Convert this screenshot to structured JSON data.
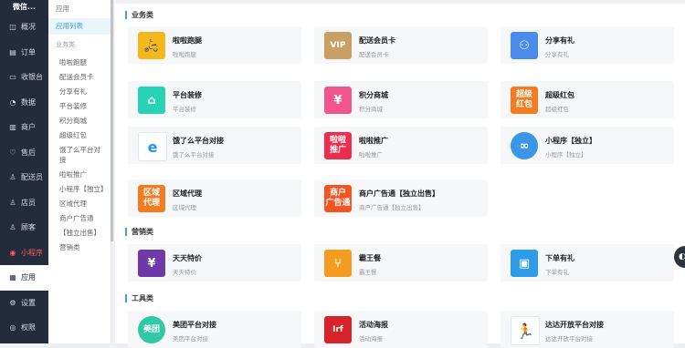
{
  "nav": {
    "brand": "微信...",
    "items": [
      {
        "label": "概况",
        "icon": "overview-icon",
        "glyph": "◫"
      },
      {
        "label": "订单",
        "icon": "order-icon",
        "glyph": "▤"
      },
      {
        "label": "收银台",
        "icon": "cashier-icon",
        "glyph": "▭"
      },
      {
        "label": "数据",
        "icon": "data-icon",
        "glyph": "◔"
      },
      {
        "label": "商户",
        "icon": "merchant-icon",
        "glyph": "▥"
      },
      {
        "label": "售后",
        "icon": "aftersale-icon",
        "glyph": "♡"
      },
      {
        "label": "配送员",
        "icon": "courier-icon",
        "glyph": "♙"
      },
      {
        "label": "店员",
        "icon": "clerk-icon",
        "glyph": "♙"
      },
      {
        "label": "顾客",
        "icon": "customer-icon",
        "glyph": "♙"
      },
      {
        "label": "小程序",
        "icon": "miniapp-icon",
        "glyph": "◉",
        "red": true
      },
      {
        "label": "应用",
        "icon": "apps-icon",
        "glyph": "▦",
        "active": true
      },
      {
        "label": "设置",
        "icon": "settings-icon",
        "glyph": "⚙"
      },
      {
        "label": "权限",
        "icon": "permission-icon",
        "glyph": "◎"
      }
    ]
  },
  "submenu": {
    "title": "应用",
    "active": "应用列表",
    "group": "业务类",
    "items": [
      "啦啦跑腿",
      "配送会员卡",
      "分享有礼",
      "平台装修",
      "积分商城",
      "超级红包",
      "饿了么平台对接",
      "啦啦推广",
      "小程序【独立】",
      "区域代理",
      "商户广告通",
      "【独立出售】",
      "营销类"
    ]
  },
  "sections": [
    {
      "title": "业务类",
      "cards": [
        {
          "name": "啦啦跑腿",
          "desc": "啦啦跑腿",
          "icon": "errand-icon",
          "glyph": "🛵",
          "color": "#f5b81c"
        },
        {
          "name": "配送会员卡",
          "desc": "配送会员卡",
          "icon": "vip-card-icon",
          "glyph": "VIP",
          "color": "#c9a063",
          "text": true
        },
        {
          "name": "分享有礼",
          "desc": "分享有礼",
          "icon": "share-gift-icon",
          "glyph": "⚇",
          "color": "#4a8cee"
        },
        {
          "name": "平台装修",
          "desc": "平台装修",
          "icon": "store-decor-icon",
          "glyph": "⌂",
          "color": "#27d3b4"
        },
        {
          "name": "积分商城",
          "desc": "积分商城",
          "icon": "points-mall-icon",
          "glyph": "¥",
          "color": "#f2548c"
        },
        {
          "name": "超级红包",
          "desc": "超级红包",
          "icon": "red-packet-icon",
          "glyph": "超级\n红包",
          "color": "#f57a20",
          "text": true
        },
        {
          "name": "饿了么平台对接",
          "desc": "饿了么平台对接",
          "icon": "eleme-icon",
          "glyph": "e",
          "color": "#1f96ee",
          "light": true
        },
        {
          "name": "啦啦推广",
          "desc": "啦啦推广",
          "icon": "promotion-icon",
          "glyph": "啦啦\n推广",
          "color": "#ee2d4e",
          "text": true
        },
        {
          "name": "小程序【独立】",
          "desc": "小程序【独立】",
          "icon": "miniprogram-icon",
          "glyph": "∞",
          "color": "#3c96e8",
          "round": true
        },
        {
          "name": "区域代理",
          "desc": "区域代理",
          "icon": "region-agent-icon",
          "glyph": "区域\n代理",
          "color": "#f57a20",
          "text": true
        },
        {
          "name": "商户广告通【独立出售】",
          "desc": "商户广告通【独立出售】",
          "icon": "merchant-ads-icon",
          "glyph": "商户\n广告通",
          "color": "#f5531f",
          "text": true
        }
      ]
    },
    {
      "title": "营销类",
      "cards": [
        {
          "name": "天天特价",
          "desc": "天天特价",
          "icon": "daily-deal-icon",
          "glyph": "¥",
          "color": "#6f3aa8"
        },
        {
          "name": "霸王餐",
          "desc": "霸王餐",
          "icon": "free-meal-icon",
          "glyph": "⑂",
          "color": "#f59b1f"
        },
        {
          "name": "下单有礼",
          "desc": "下单有礼",
          "icon": "order-gift-icon",
          "glyph": "▣",
          "color": "#2d9be8"
        }
      ]
    },
    {
      "title": "工具类",
      "cards": [
        {
          "name": "美团平台对接",
          "desc": "美团平台对接",
          "icon": "meituan-icon",
          "glyph": "美团",
          "color": "#30c9a6",
          "text": true,
          "round": true
        },
        {
          "name": "活动海报",
          "desc": "活动海报",
          "icon": "poster-icon",
          "glyph": "Irf",
          "color": "#d8232a",
          "text": true
        },
        {
          "name": "达达开放平台对接",
          "desc": "达达开放平台对接",
          "icon": "dada-icon",
          "glyph": "🏃",
          "color": "#1a84f0",
          "light": true
        }
      ]
    }
  ],
  "float_button": {
    "icon": "chat-icon",
    "glyph": "◐"
  }
}
